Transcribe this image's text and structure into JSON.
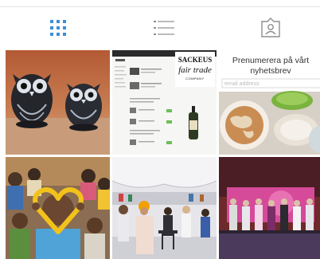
{
  "tabs": [
    {
      "name": "grid-view",
      "icon": "grid-icon"
    },
    {
      "name": "list-view",
      "icon": "list-icon"
    },
    {
      "name": "tagged-view",
      "icon": "tagged-person-icon"
    }
  ],
  "colors": {
    "accent": "#3a8fd9",
    "icon_grey": "#8e8e8e"
  },
  "posts": [
    {
      "id": "owls",
      "icon": "owl-figurines-image"
    },
    {
      "id": "webshop",
      "icon": "webshop-screenshot-image",
      "logo": {
        "line1": "SACKEUS",
        "line2": "fair trade",
        "line3": "COMPANY"
      }
    },
    {
      "id": "newsletter",
      "icon": "newsletter-image",
      "title_line1": "Prenumerera på vårt",
      "title_line2": "nyhetsbrev",
      "email_placeholder": "email address"
    },
    {
      "id": "children",
      "icon": "children-heart-image"
    },
    {
      "id": "tent-event",
      "icon": "tent-event-image"
    },
    {
      "id": "stage",
      "icon": "stage-performance-image"
    }
  ]
}
